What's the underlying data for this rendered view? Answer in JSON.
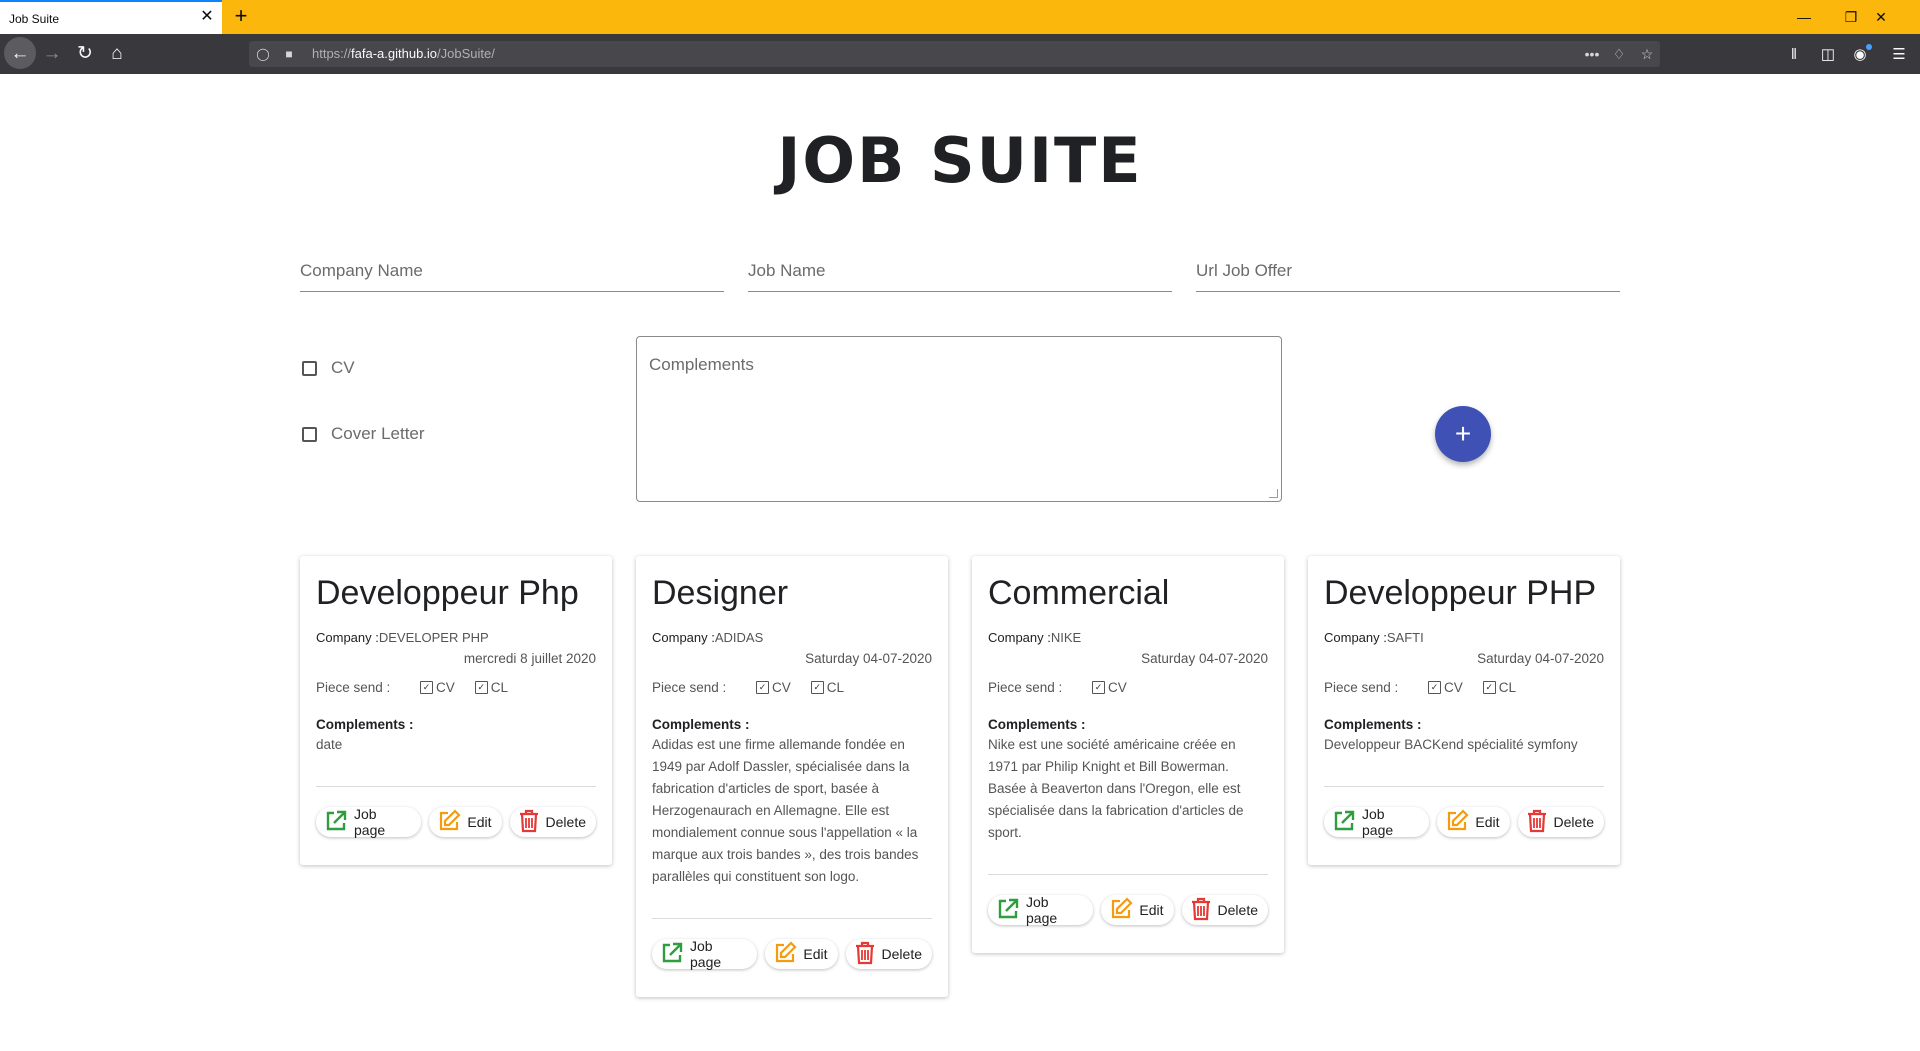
{
  "browser": {
    "tab_title": "Job Suite",
    "close_glyph": "✕",
    "newtab_glyph": "+",
    "url_prefix": "https://",
    "url_host": "fafa-a.github.io",
    "url_path": "/JobSuite/",
    "page_actions_glyph": "•••"
  },
  "app": {
    "title": "JOB SUITE",
    "form": {
      "company_placeholder": "Company Name",
      "job_placeholder": "Job Name",
      "url_placeholder": "Url Job Offer",
      "cv_label": "CV",
      "cover_letter_label": "Cover Letter",
      "complements_placeholder": "Complements",
      "add_glyph": "+"
    },
    "accent_color": "#3f51b5"
  },
  "cards": [
    {
      "title": "Developpeur Php",
      "company_label": "Company :",
      "company": "DEVELOPER PHP",
      "date": "mercredi 8 juillet 2020",
      "piece_label": "Piece send :",
      "pieces": [
        "CV",
        "CL"
      ],
      "complements_label": "Complements :",
      "complements": "date",
      "job_page": "Job page",
      "edit": "Edit",
      "delete": "Delete"
    },
    {
      "title": "Designer",
      "company_label": "Company :",
      "company": "ADIDAS",
      "date": "Saturday 04-07-2020",
      "piece_label": "Piece send :",
      "pieces": [
        "CV",
        "CL"
      ],
      "complements_label": "Complements :",
      "complements": "Adidas est une firme allemande fondée en 1949 par Adolf Dassler, spécialisée dans la fabrication d'articles de sport, basée à Herzogenaurach en Allemagne. Elle est mondialement connue sous l'appellation « la marque aux trois bandes », des trois bandes parallèles qui constituent son logo.",
      "job_page": "Job page",
      "edit": "Edit",
      "delete": "Delete"
    },
    {
      "title": "Commercial",
      "company_label": "Company :",
      "company": "NIKE",
      "date": "Saturday 04-07-2020",
      "piece_label": "Piece send :",
      "pieces": [
        "CV"
      ],
      "complements_label": "Complements :",
      "complements": "Nike est une société américaine créée en 1971 par Philip Knight et Bill Bowerman. Basée à Beaverton dans l'Oregon, elle est spécialisée dans la fabrication d'articles de sport.",
      "job_page": "Job page",
      "edit": "Edit",
      "delete": "Delete"
    },
    {
      "title": "Developpeur PHP",
      "company_label": "Company :",
      "company": "SAFTI",
      "date": "Saturday 04-07-2020",
      "piece_label": "Piece send :",
      "pieces": [
        "CV",
        "CL"
      ],
      "complements_label": "Complements :",
      "complements": "Developpeur BACKend spécialité symfony",
      "job_page": "Job page",
      "edit": "Edit",
      "delete": "Delete"
    }
  ],
  "icons": {
    "job_page": "external-link-icon",
    "edit": "edit-icon",
    "delete": "trash-icon",
    "colors": {
      "job_page": "#2e9e3e",
      "edit": "#f39c12",
      "delete": "#e53935"
    }
  }
}
